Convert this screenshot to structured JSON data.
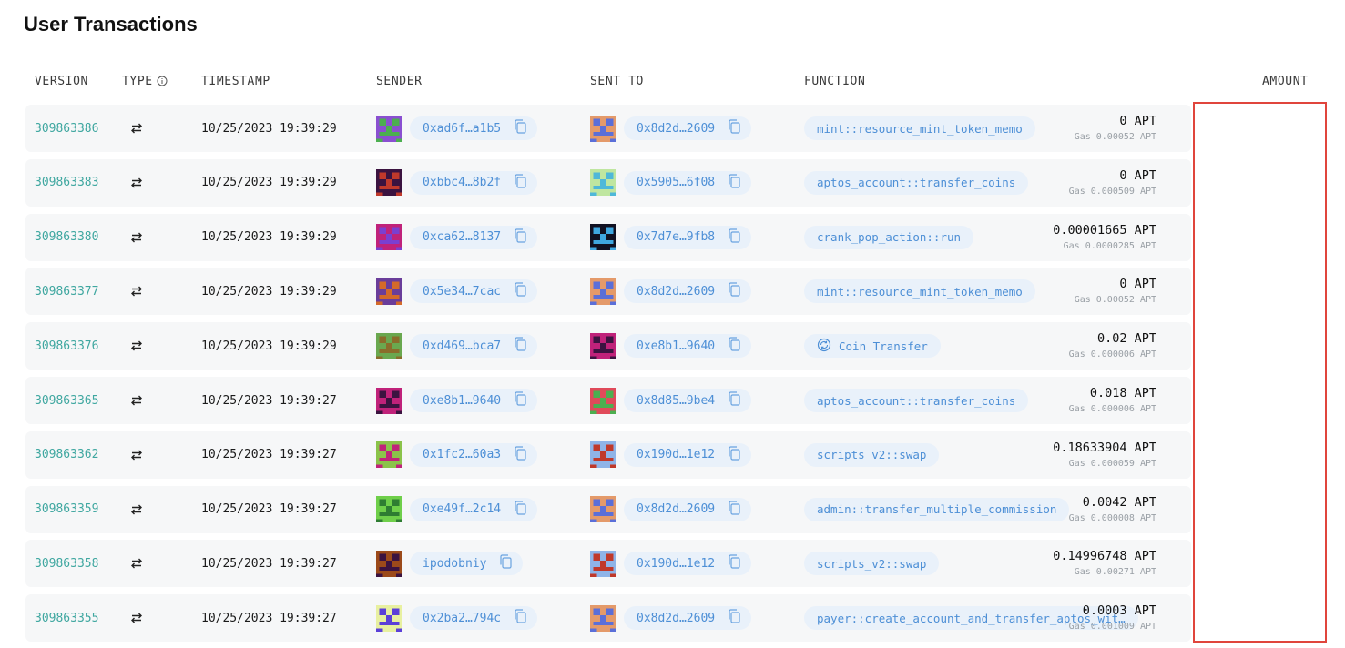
{
  "page": {
    "title": "User Transactions"
  },
  "columns": {
    "version": "VERSION",
    "type": "TYPE",
    "timestamp": "TIMESTAMP",
    "sender": "SENDER",
    "sent_to": "SENT TO",
    "function": "FUNCTION",
    "amount": "AMOUNT"
  },
  "colors": {
    "version_link": "#3fa7a0",
    "address_text": "#4d8fd6",
    "pill_bg": "#e9f1fa",
    "row_bg": "#f6f7f8",
    "highlight_border": "#e0453c"
  },
  "icons": {
    "type": "transfer-arrows-icon",
    "copy": "copy-icon",
    "info": "info-icon",
    "coin_transfer": "coin-transfer-icon"
  },
  "rows": [
    {
      "version": "309863386",
      "timestamp": "10/25/2023 19:39:29",
      "sender": "0xad6f…a1b5",
      "sent_to": "0x8d2d…2609",
      "function": "mint::resource_mint_token_memo",
      "amount": "0 APT",
      "gas": "Gas 0.00052 APT",
      "sender_avatar": [
        "#8a4fd1",
        "#4caf50"
      ],
      "to_avatar": [
        "#e49a6a",
        "#5b6fd8"
      ]
    },
    {
      "version": "309863383",
      "timestamp": "10/25/2023 19:39:29",
      "sender": "0xbbc4…8b2f",
      "sent_to": "0x5905…6f08",
      "function": "aptos_account::transfer_coins",
      "amount": "0 APT",
      "gas": "Gas 0.000509 APT",
      "sender_avatar": [
        "#3b1340",
        "#c0392b"
      ],
      "to_avatar": [
        "#bfe6a0",
        "#4fb8d8"
      ]
    },
    {
      "version": "309863380",
      "timestamp": "10/25/2023 19:39:29",
      "sender": "0xca62…8137",
      "sent_to": "0x7d7e…9fb8",
      "function": "crank_pop_action::run",
      "amount": "0.00001665 APT",
      "gas": "Gas 0.0000285 APT",
      "sender_avatar": [
        "#c0227a",
        "#7a3fd1"
      ],
      "to_avatar": [
        "#111122",
        "#3fa7e0"
      ]
    },
    {
      "version": "309863377",
      "timestamp": "10/25/2023 19:39:29",
      "sender": "0x5e34…7cac",
      "sent_to": "0x8d2d…2609",
      "function": "mint::resource_mint_token_memo",
      "amount": "0 APT",
      "gas": "Gas 0.00052 APT",
      "sender_avatar": [
        "#6a3d9a",
        "#d46a2a"
      ],
      "to_avatar": [
        "#e49a6a",
        "#5b6fd8"
      ]
    },
    {
      "version": "309863376",
      "timestamp": "10/25/2023 19:39:29",
      "sender": "0xd469…bca7",
      "sent_to": "0xe8b1…9640",
      "function": "Coin Transfer",
      "function_icon": true,
      "amount": "0.02 APT",
      "gas": "Gas 0.000006 APT",
      "sender_avatar": [
        "#6aa84f",
        "#8a6d2a"
      ],
      "to_avatar": [
        "#c0227a",
        "#3b1340"
      ]
    },
    {
      "version": "309863365",
      "timestamp": "10/25/2023 19:39:27",
      "sender": "0xe8b1…9640",
      "sent_to": "0x8d85…9be4",
      "function": "aptos_account::transfer_coins",
      "amount": "0.018 APT",
      "gas": "Gas 0.000006 APT",
      "sender_avatar": [
        "#c0227a",
        "#3b1340"
      ],
      "to_avatar": [
        "#e04a5a",
        "#4caf50"
      ]
    },
    {
      "version": "309863362",
      "timestamp": "10/25/2023 19:39:27",
      "sender": "0x1fc2…60a3",
      "sent_to": "0x190d…1e12",
      "function": "scripts_v2::swap",
      "amount": "0.18633904 APT",
      "gas": "Gas 0.000059 APT",
      "sender_avatar": [
        "#8bc34a",
        "#c0227a"
      ],
      "to_avatar": [
        "#8fb4e8",
        "#c0392b"
      ]
    },
    {
      "version": "309863359",
      "timestamp": "10/25/2023 19:39:27",
      "sender": "0xe49f…2c14",
      "sent_to": "0x8d2d…2609",
      "function": "admin::transfer_multiple_commission",
      "amount": "0.0042 APT",
      "gas": "Gas 0.000008 APT",
      "sender_avatar": [
        "#6fcf4a",
        "#2e7d32"
      ],
      "to_avatar": [
        "#e49a6a",
        "#5b6fd8"
      ]
    },
    {
      "version": "309863358",
      "timestamp": "10/25/2023 19:39:27",
      "sender": "ipodobniy",
      "sent_to": "0x190d…1e12",
      "function": "scripts_v2::swap",
      "amount": "0.14996748 APT",
      "gas": "Gas 0.00271 APT",
      "sender_avatar": [
        "#9c4a1a",
        "#3b1340"
      ],
      "to_avatar": [
        "#8fb4e8",
        "#c0392b"
      ]
    },
    {
      "version": "309863355",
      "timestamp": "10/25/2023 19:39:27",
      "sender": "0x2ba2…794c",
      "sent_to": "0x8d2d…2609",
      "function": "payer::create_account_and_transfer_aptos_wit…",
      "amount": "0.0003 APT",
      "gas": "Gas 0.001009 APT",
      "sender_avatar": [
        "#e8f0a0",
        "#5b3fd8"
      ],
      "to_avatar": [
        "#e49a6a",
        "#5b6fd8"
      ]
    }
  ]
}
